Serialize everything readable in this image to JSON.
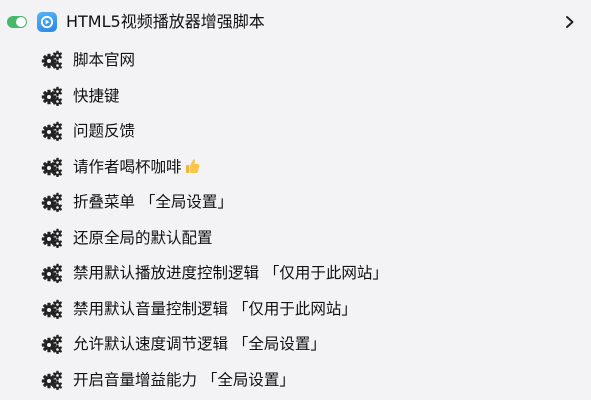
{
  "header": {
    "title": "HTML5视频播放器增强脚本",
    "toggle_icon": "toggle-on-icon",
    "app_icon": "video-player-app-icon",
    "expand_icon": "chevron-right-icon",
    "toggle_color": "#48b86a",
    "app_icon_color": "#2a86e6"
  },
  "menu": {
    "item_icon": "gear-icon",
    "items": [
      {
        "label": "脚本官网"
      },
      {
        "label": "快捷键"
      },
      {
        "label": "问题反馈"
      },
      {
        "label": "请作者喝杯咖啡",
        "emoji_icon": "thumbs-up-icon"
      },
      {
        "label": "折叠菜单 「全局设置」"
      },
      {
        "label": "还原全局的默认配置"
      },
      {
        "label": "禁用默认播放进度控制逻辑 「仅用于此网站」"
      },
      {
        "label": "禁用默认音量控制逻辑 「仅用于此网站」"
      },
      {
        "label": "允许默认速度调节逻辑 「全局设置」"
      },
      {
        "label": "开启音量增益能力 「全局设置」"
      }
    ]
  }
}
